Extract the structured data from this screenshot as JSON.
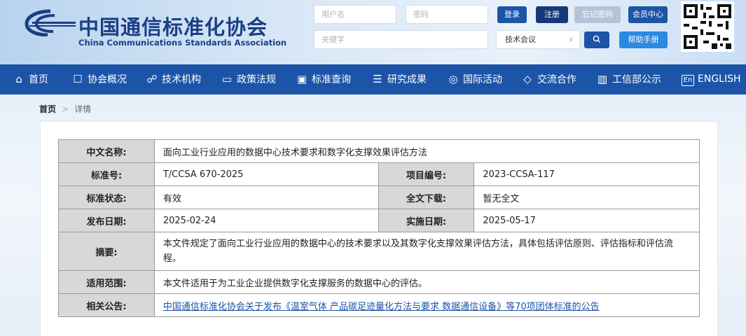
{
  "header": {
    "logo_cn": "中国通信标准化协会",
    "logo_en": "China Communications Standards Association",
    "username_placeholder": "用户名",
    "password_placeholder": "密码",
    "keyword_placeholder": "关键字",
    "login_label": "登录",
    "register_label": "注册",
    "forgot_label": "忘记密码",
    "member_label": "会员中心",
    "select_value": "技术会议",
    "search_icon": "Q",
    "help_label": "帮助手册"
  },
  "nav": {
    "items": [
      {
        "label": "首页",
        "icon": "home-icon"
      },
      {
        "label": "协会概况",
        "icon": "chart-icon"
      },
      {
        "label": "技术机构",
        "icon": "org-icon"
      },
      {
        "label": "政策法规",
        "icon": "window-icon"
      },
      {
        "label": "标准查询",
        "icon": "monitor-icon"
      },
      {
        "label": "研究成果",
        "icon": "doc-icon"
      },
      {
        "label": "国际活动",
        "icon": "globe-icon"
      },
      {
        "label": "交流合作",
        "icon": "handshake-icon"
      },
      {
        "label": "工信部公示",
        "icon": "board-icon"
      },
      {
        "label": "ENGLISH",
        "icon": "en-icon"
      }
    ]
  },
  "breadcrumb": {
    "home": "首页",
    "current": "详情"
  },
  "detail": {
    "cn_name_label": "中文名称:",
    "cn_name": "面向工业行业应用的数据中心技术要求和数字化支撑效果评估方法",
    "std_no_label": "标准号:",
    "std_no": "T/CCSA 670-2025",
    "proj_no_label": "项目编号:",
    "proj_no": "2023-CCSA-117",
    "status_label": "标准状态:",
    "status": "有效",
    "download_label": "全文下载:",
    "download": "暂无全文",
    "pub_date_label": "发布日期:",
    "pub_date": "2025-02-24",
    "impl_date_label": "实施日期:",
    "impl_date": "2025-05-17",
    "abstract_label": "摘要:",
    "abstract": "本文件规定了面向工业行业应用的数据中心的技术要求以及其数字化支撑效果评估方法，具体包括评估原则、评估指标和评估流程。",
    "scope_label": "适用范围:",
    "scope": "本文件适用于为工业企业提供数字化支撑服务的数据中心的评估。",
    "notice_label": "相关公告:",
    "notice": "中国通信标准化协会关于发布《温室气体 产品碳足迹量化方法与要求 数据通信设备》等70项团体标准的公告"
  }
}
